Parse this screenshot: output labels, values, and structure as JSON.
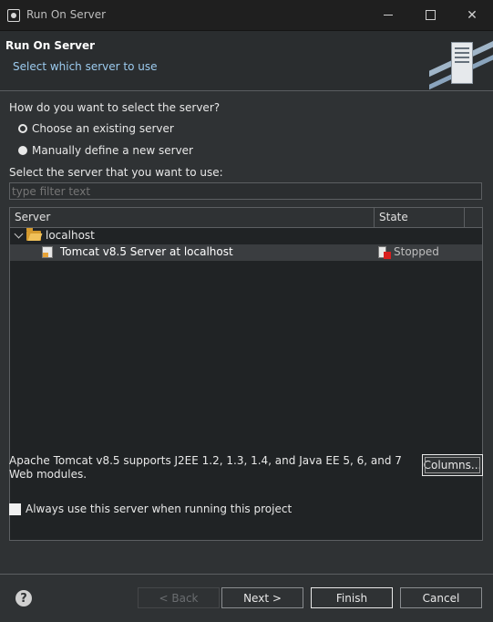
{
  "window": {
    "title": "Run On Server"
  },
  "header": {
    "title": "Run On Server",
    "description": "Select which server to use"
  },
  "question": "How do you want to select the server?",
  "options": [
    {
      "label": "Choose an existing server",
      "selected": true
    },
    {
      "label": "Manually define a new server",
      "selected": false
    }
  ],
  "select_label": "Select the server that you want to use:",
  "filter": {
    "placeholder": "type filter text",
    "value": ""
  },
  "table": {
    "columns": [
      "Server",
      "State"
    ],
    "host": "localhost",
    "server": {
      "name": "Tomcat v8.5 Server at localhost",
      "state": "Stopped"
    }
  },
  "description": "Apache Tomcat v8.5 supports J2EE 1.2, 1.3, 1.4, and Java EE 5, 6, and 7 Web modules.",
  "columns_button": "Columns...",
  "always_use": {
    "label": "Always use this server when running this project",
    "checked": false
  },
  "buttons": {
    "back": "< Back",
    "next": "Next >",
    "finish": "Finish",
    "cancel": "Cancel"
  },
  "icons": {
    "app": "eclipse-icon",
    "help": "help-icon",
    "folder": "folder-icon",
    "server": "server-icon",
    "stopped": "server-stopped-icon"
  }
}
